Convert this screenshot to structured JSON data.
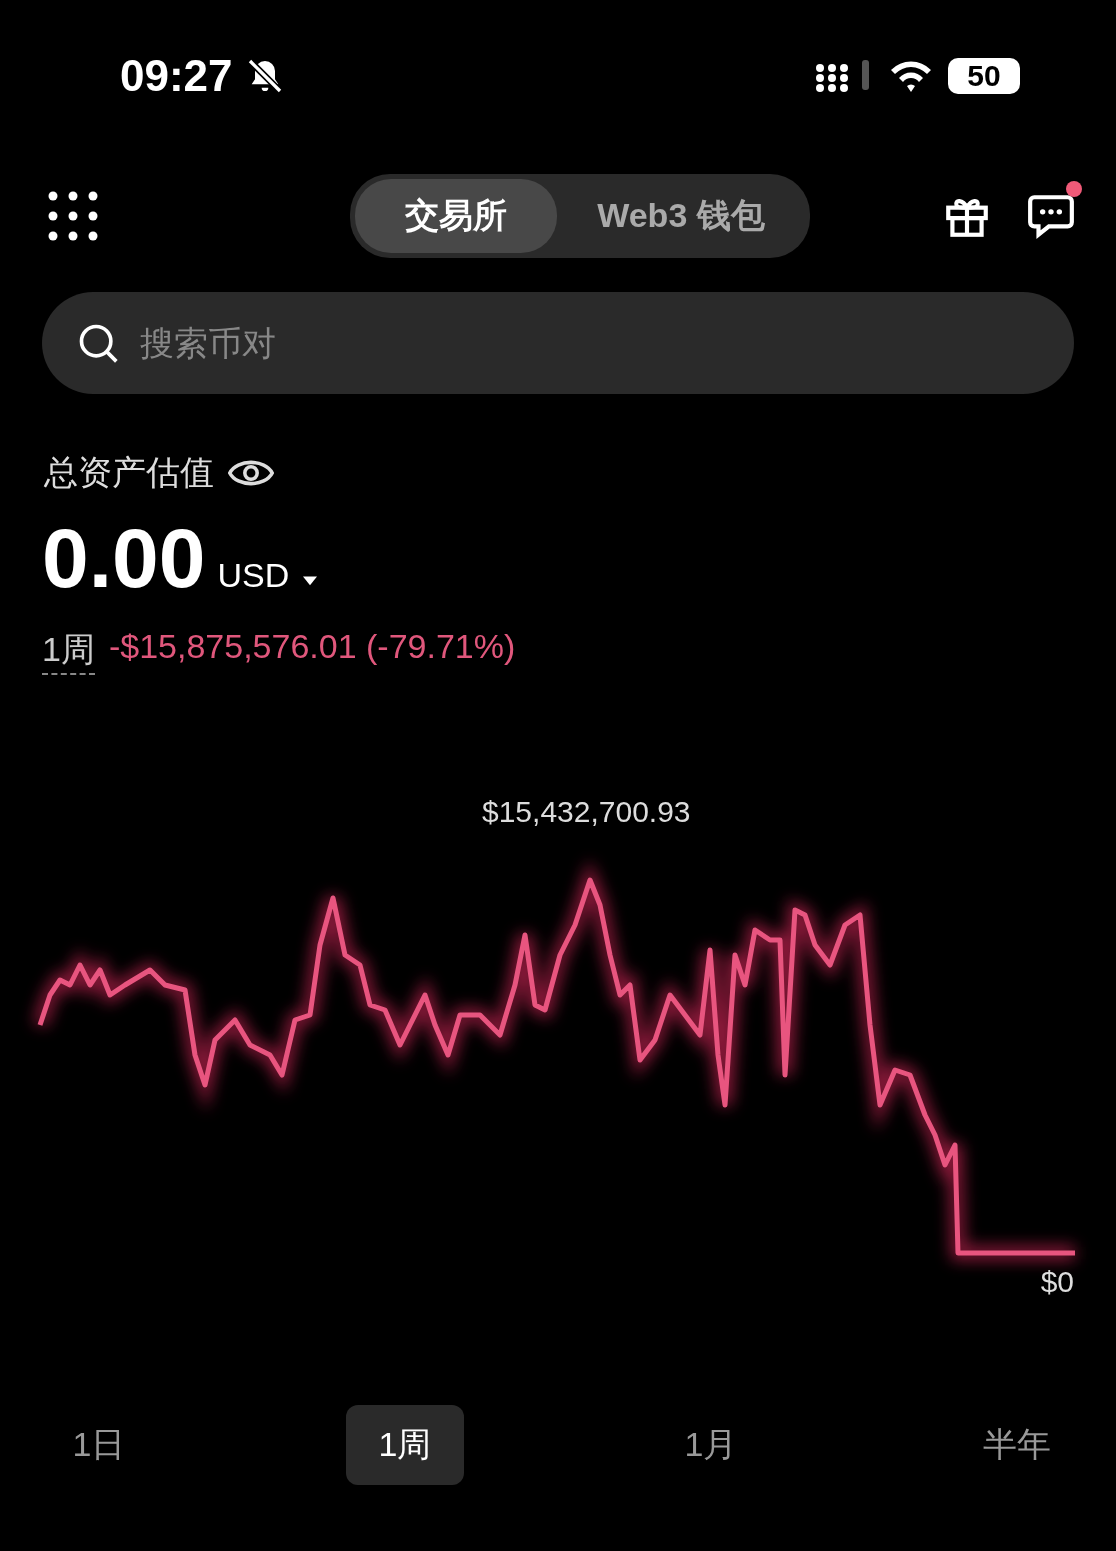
{
  "status_bar": {
    "time": "09:27",
    "silent": true,
    "battery": "50"
  },
  "header": {
    "tabs": [
      {
        "label": "交易所",
        "selected": true
      },
      {
        "label": "Web3 钱包",
        "selected": false
      }
    ],
    "chat_unread": true
  },
  "search": {
    "placeholder": "搜索币对"
  },
  "balance": {
    "label": "总资产估值",
    "value": "0.00",
    "currency": "USD"
  },
  "change": {
    "period": "1周",
    "amount": "-$15,875,576.01 (-79.71%)"
  },
  "chart": {
    "high_label": "$15,432,700.93",
    "low_label": "$0"
  },
  "periods": [
    {
      "label": "1日",
      "selected": false
    },
    {
      "label": "1周",
      "selected": true
    },
    {
      "label": "1月",
      "selected": false
    },
    {
      "label": "半年",
      "selected": false
    }
  ]
}
